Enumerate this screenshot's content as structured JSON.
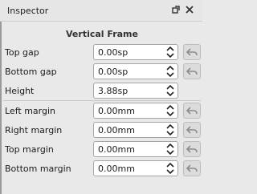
{
  "window": {
    "title": "Inspector"
  },
  "section": {
    "title": "Vertical Frame"
  },
  "rows": [
    {
      "label": "Top gap",
      "value": "0.00sp"
    },
    {
      "label": "Bottom gap",
      "value": "0.00sp"
    },
    {
      "label": "Height",
      "value": "3.88sp"
    },
    {
      "label": "Left margin",
      "value": "0.00mm"
    },
    {
      "label": "Right margin",
      "value": "0.00mm"
    },
    {
      "label": "Top margin",
      "value": "0.00mm"
    },
    {
      "label": "Bottom margin",
      "value": "0.00mm"
    }
  ],
  "icons": {
    "float": "float-icon",
    "close": "close-icon",
    "spin": "spin-arrows-icon",
    "reset": "reset-icon"
  }
}
